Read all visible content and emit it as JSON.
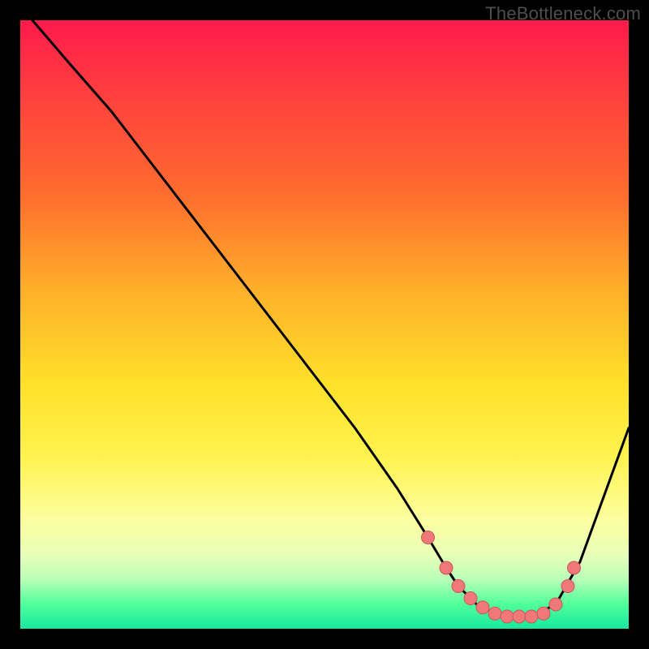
{
  "watermark": "TheBottleneck.com",
  "chart_data": {
    "type": "line",
    "title": "",
    "xlabel": "",
    "ylabel": "",
    "xlim": [
      0,
      100
    ],
    "ylim": [
      0,
      100
    ],
    "series": [
      {
        "name": "curve",
        "x": [
          2,
          8,
          15,
          25,
          35,
          45,
          55,
          62,
          67,
          70,
          72,
          75,
          78,
          80,
          83,
          85,
          88,
          92,
          96,
          100
        ],
        "y": [
          100,
          93,
          85,
          72,
          59,
          46,
          33,
          23,
          15,
          10,
          7,
          4,
          2.5,
          2,
          2,
          2.5,
          4,
          11,
          22,
          33
        ]
      }
    ],
    "markers": {
      "name": "highlight-dots",
      "x": [
        67,
        70,
        72,
        74,
        76,
        78,
        80,
        82,
        84,
        86,
        88,
        90,
        91
      ],
      "y": [
        15,
        10,
        7,
        5,
        3.5,
        2.5,
        2,
        2,
        2,
        2.5,
        4,
        7,
        10
      ]
    },
    "background": "rainbow-vertical-gradient"
  }
}
